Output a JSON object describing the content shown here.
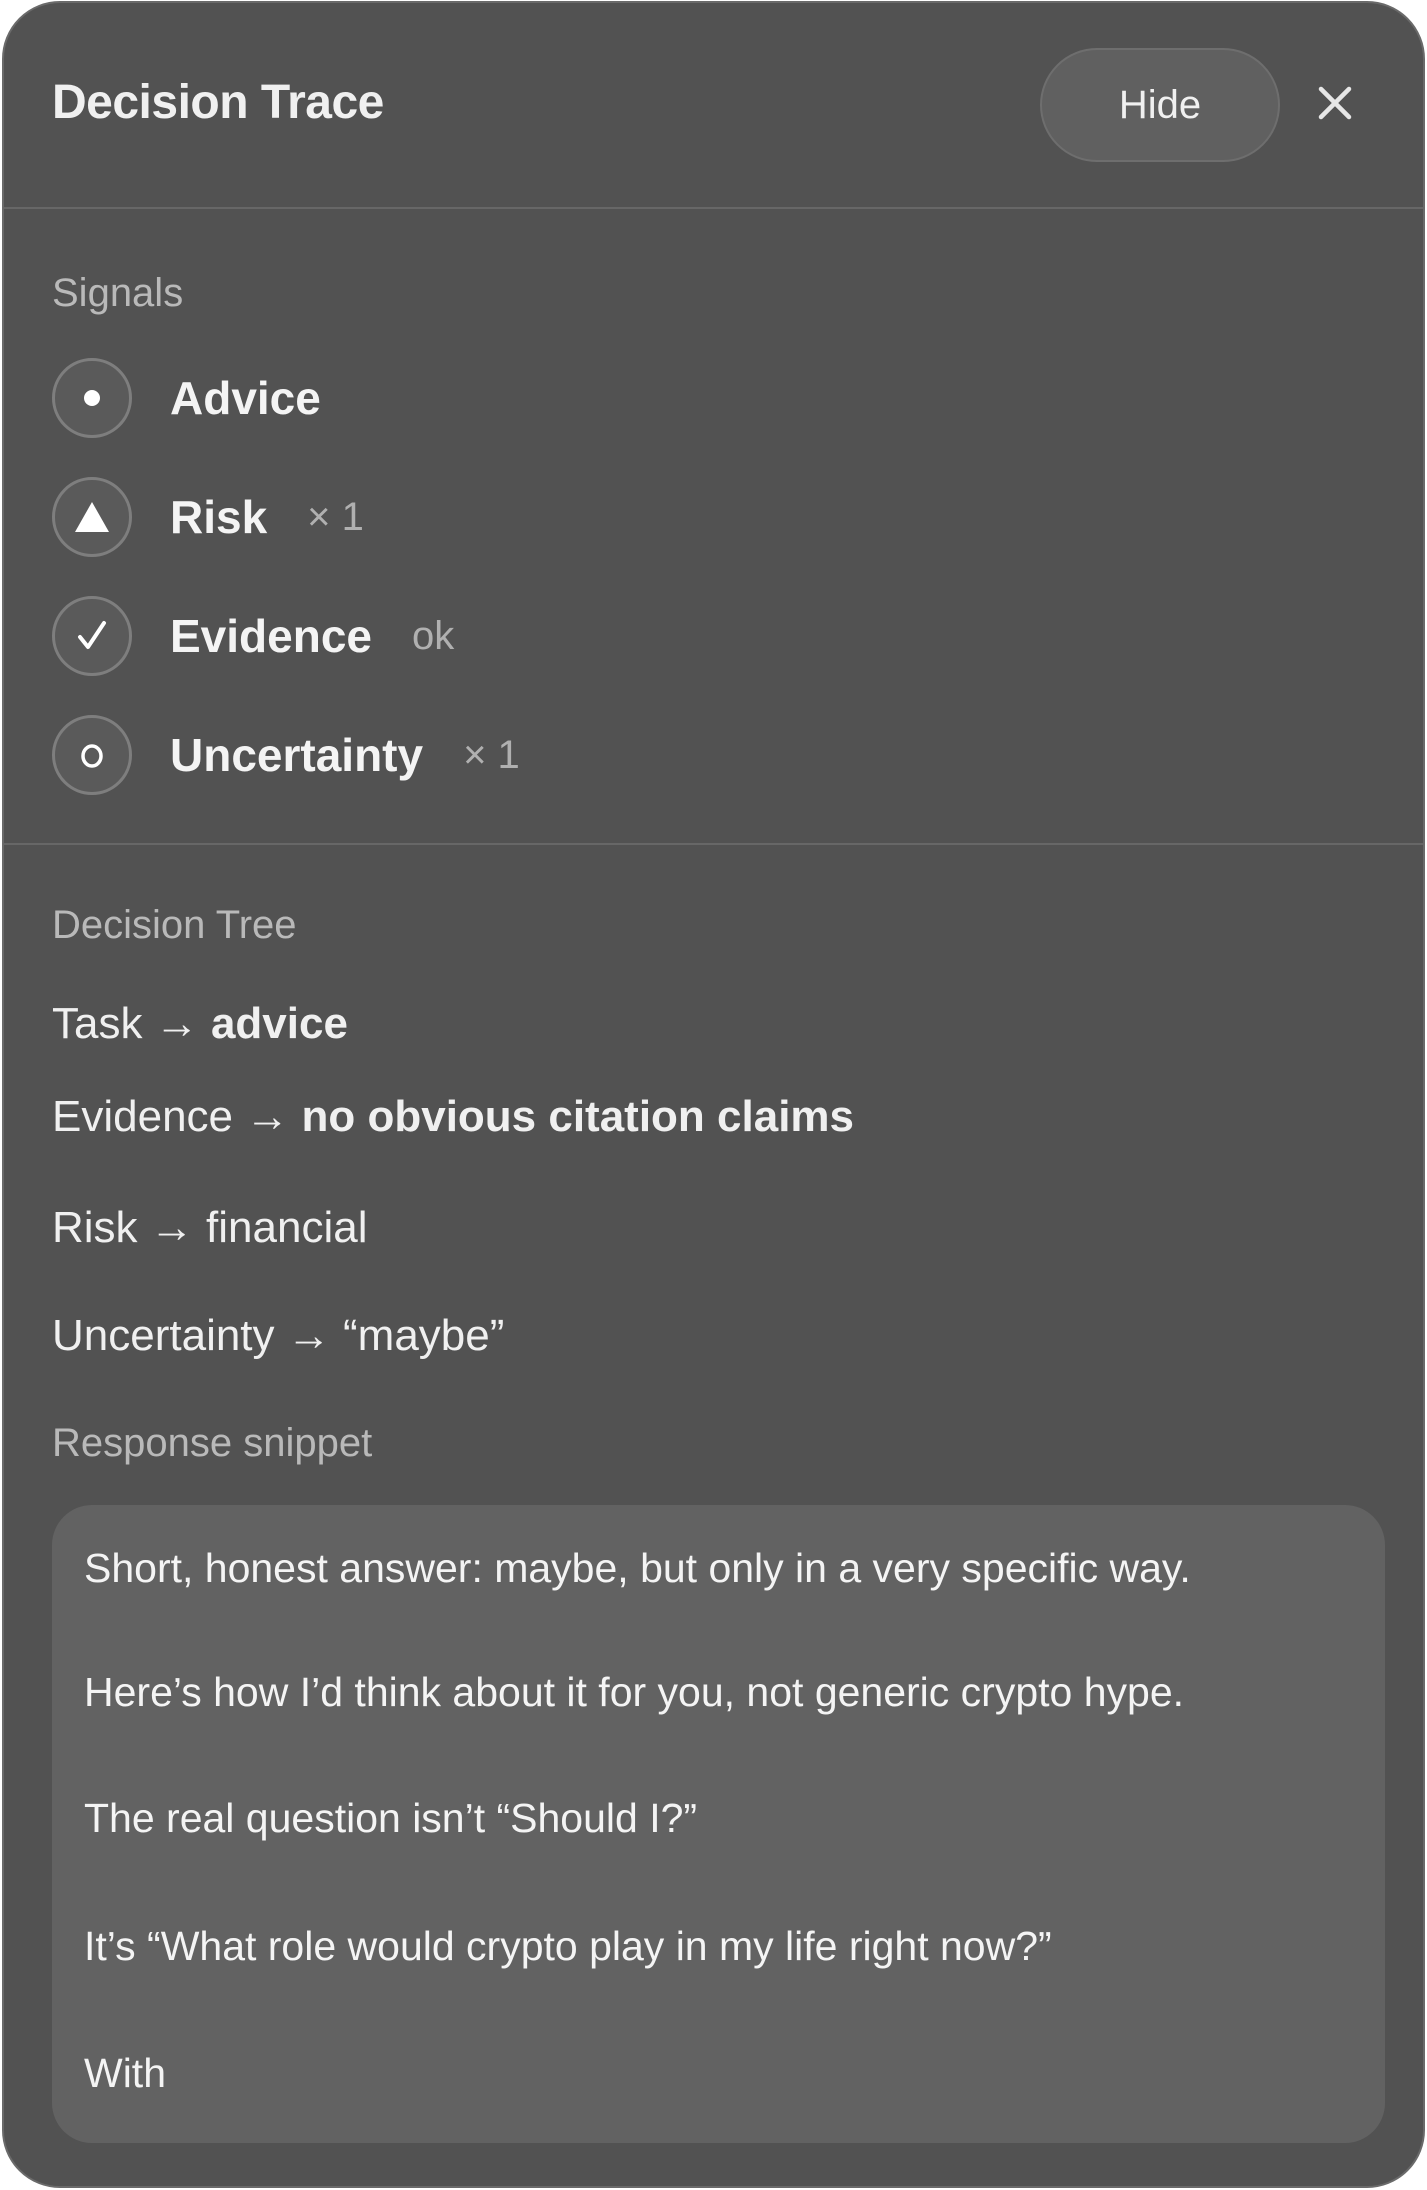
{
  "header": {
    "title": "Decision Trace",
    "hide_label": "Hide",
    "close_icon": "close-icon"
  },
  "signals": {
    "label": "Signals",
    "items": [
      {
        "name": "Advice",
        "icon": "dot-icon",
        "extra": ""
      },
      {
        "name": "Risk",
        "icon": "warning-triangle-icon",
        "extra": "× 1"
      },
      {
        "name": "Evidence",
        "icon": "check-icon",
        "extra": "ok"
      },
      {
        "name": "Uncertainty",
        "icon": "circle-o-icon",
        "extra": "× 1"
      }
    ]
  },
  "decision_tree": {
    "label": "Decision Tree",
    "rows": [
      {
        "key": "Task",
        "arrow": "→",
        "value": "advice",
        "bold": true
      },
      {
        "key": "Evidence",
        "arrow": "→",
        "value": "no obvious citation claims",
        "bold": true
      },
      {
        "key": "Risk",
        "arrow": "→",
        "value": "financial",
        "bold": false
      },
      {
        "key": "Uncertainty",
        "arrow": "→",
        "value": "“maybe”",
        "bold": false
      }
    ]
  },
  "response": {
    "label": "Response snippet",
    "lines": [
      "Short, honest answer: maybe, but only in a very specific way.",
      "Here’s how I’d think about it for you, not generic crypto hype.",
      "The real question isn’t “Should I?”",
      "It’s “What role would crypto play in my life right now?”",
      "With"
    ]
  }
}
